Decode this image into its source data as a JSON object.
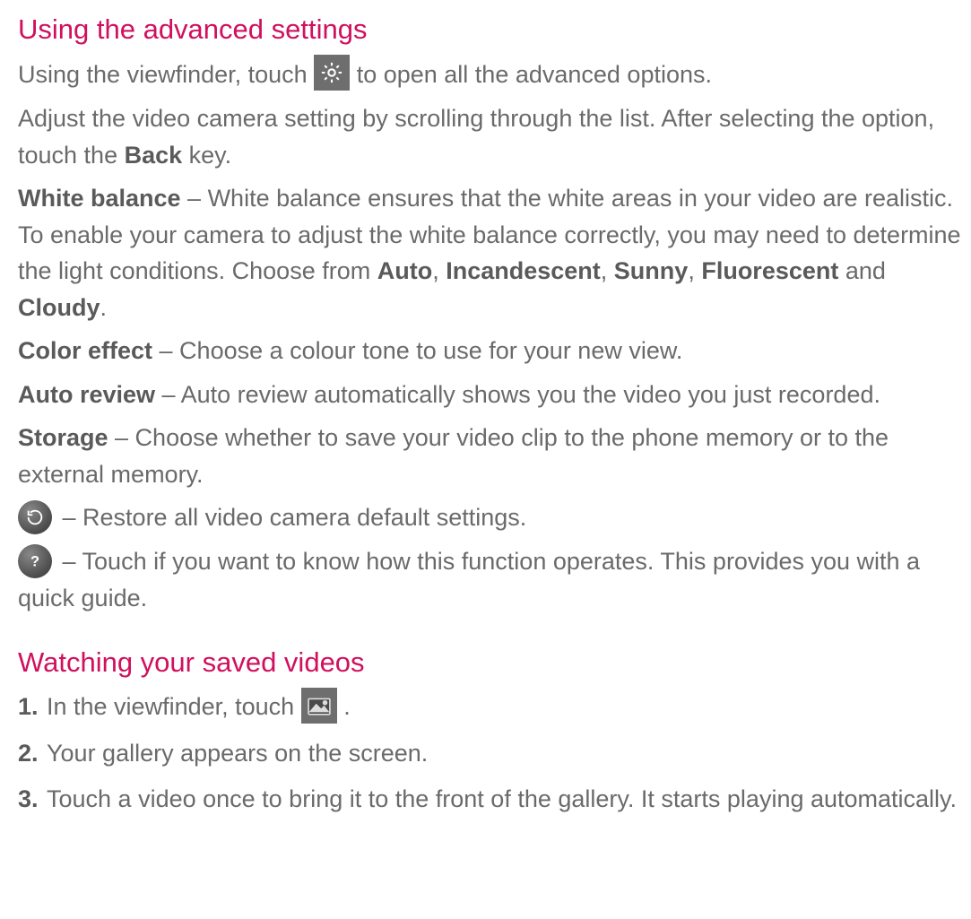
{
  "heading1": "Using the advanced settings",
  "p1a": "Using the viewfinder, touch ",
  "p1b": " to open all the advanced options.",
  "p2a": "Adjust the video camera setting by scrolling through the list. After selecting the option, touch the ",
  "p2b": "Back",
  "p2c": " key.",
  "wb": {
    "label": "White balance",
    "text1": " – White balance ensures that the white areas in your video are realistic. To enable your camera to adjust the white balance correctly, you may need to determine the light conditions. Choose from ",
    "opt1": "Auto",
    "sep1": ", ",
    "opt2": "Incandescent",
    "sep2": ", ",
    "opt3": "Sunny",
    "sep3": ", ",
    "opt4": "Fluorescent",
    "and": " and ",
    "opt5": "Cloudy",
    "end": "."
  },
  "ce": {
    "label": "Color effect",
    "text": " – Choose a colour tone to use for your new view."
  },
  "ar": {
    "label": "Auto review",
    "text": " – Auto review automatically shows you the video you just recorded."
  },
  "st": {
    "label": "Storage",
    "text": " – Choose whether to save your video clip to the phone memory or to the external memory."
  },
  "restore": " – Restore all video camera default settings.",
  "help": " – Touch if you want to know how this function operates. This provides you with a quick guide.",
  "heading2": "Watching your saved videos",
  "li1a": "In the viewfinder, touch ",
  "li1b": ".",
  "li2": "Your gallery appears on the screen.",
  "li3": "Touch a video once to bring it to the front of the gallery. It starts playing automatically."
}
